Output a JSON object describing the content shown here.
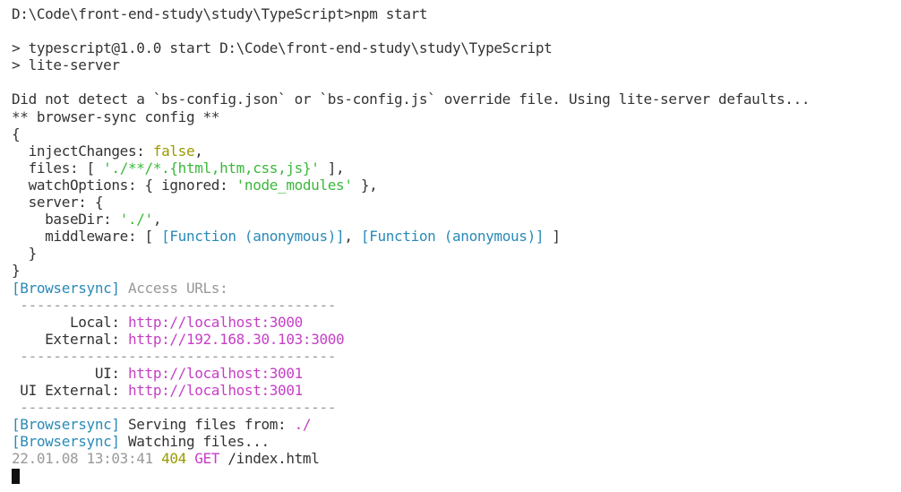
{
  "prompt": {
    "cwd": "D:\\Code\\front-end-study\\study\\TypeScript",
    "command": "npm start"
  },
  "npm": {
    "run_line": "> typescript@1.0.0 start D:\\Code\\front-end-study\\study\\TypeScript",
    "script_line": "> lite-server"
  },
  "warning": "Did not detect a `bs-config.json` or `bs-config.js` override file. Using lite-server defaults...",
  "config_header": "** browser-sync config **",
  "config": {
    "open_brace": "{",
    "inject_key": "  injectChanges: ",
    "inject_val": "false",
    "inject_end": ",",
    "files_key": "  files: [ ",
    "files_val": "'./**/*.{html,htm,css,js}'",
    "files_end": " ],",
    "watch_key": "  watchOptions: { ignored: ",
    "watch_val": "'node_modules'",
    "watch_end": " },",
    "server_key": "  server: {",
    "basedir_key": "    baseDir: ",
    "basedir_val": "'./'",
    "basedir_end": ",",
    "middleware_key": "    middleware: [ ",
    "middleware_fn1": "[Function (anonymous)]",
    "middleware_sep": ", ",
    "middleware_fn2": "[Function (anonymous)]",
    "middleware_end": " ]",
    "server_close": "  }",
    "close_brace": "}"
  },
  "browsersync": {
    "tag": "[Browsersync]",
    "access_label": " Access URLs:",
    "divider": " --------------------------------------",
    "local_label": "       Local: ",
    "local_url": "http://localhost:3000",
    "external_label": "    External: ",
    "external_url": "http://192.168.30.103:3000",
    "ui_label": "          UI: ",
    "ui_url": "http://localhost:3001",
    "ui_external_label": " UI External: ",
    "ui_external_url": "http://localhost:3001",
    "serving_text": " Serving files from: ",
    "serving_path": "./",
    "watching_text": " Watching files..."
  },
  "log": {
    "timestamp": "22.01.08 13:03:41 ",
    "status": "404",
    "method": " GET",
    "path": " /index.html"
  },
  "colors": {
    "tag": "#2a8ab8",
    "string": "#3cb83c",
    "boolean": "#9a9a00",
    "url": "#c63fc6",
    "muted": "#999999",
    "text": "#333333"
  }
}
